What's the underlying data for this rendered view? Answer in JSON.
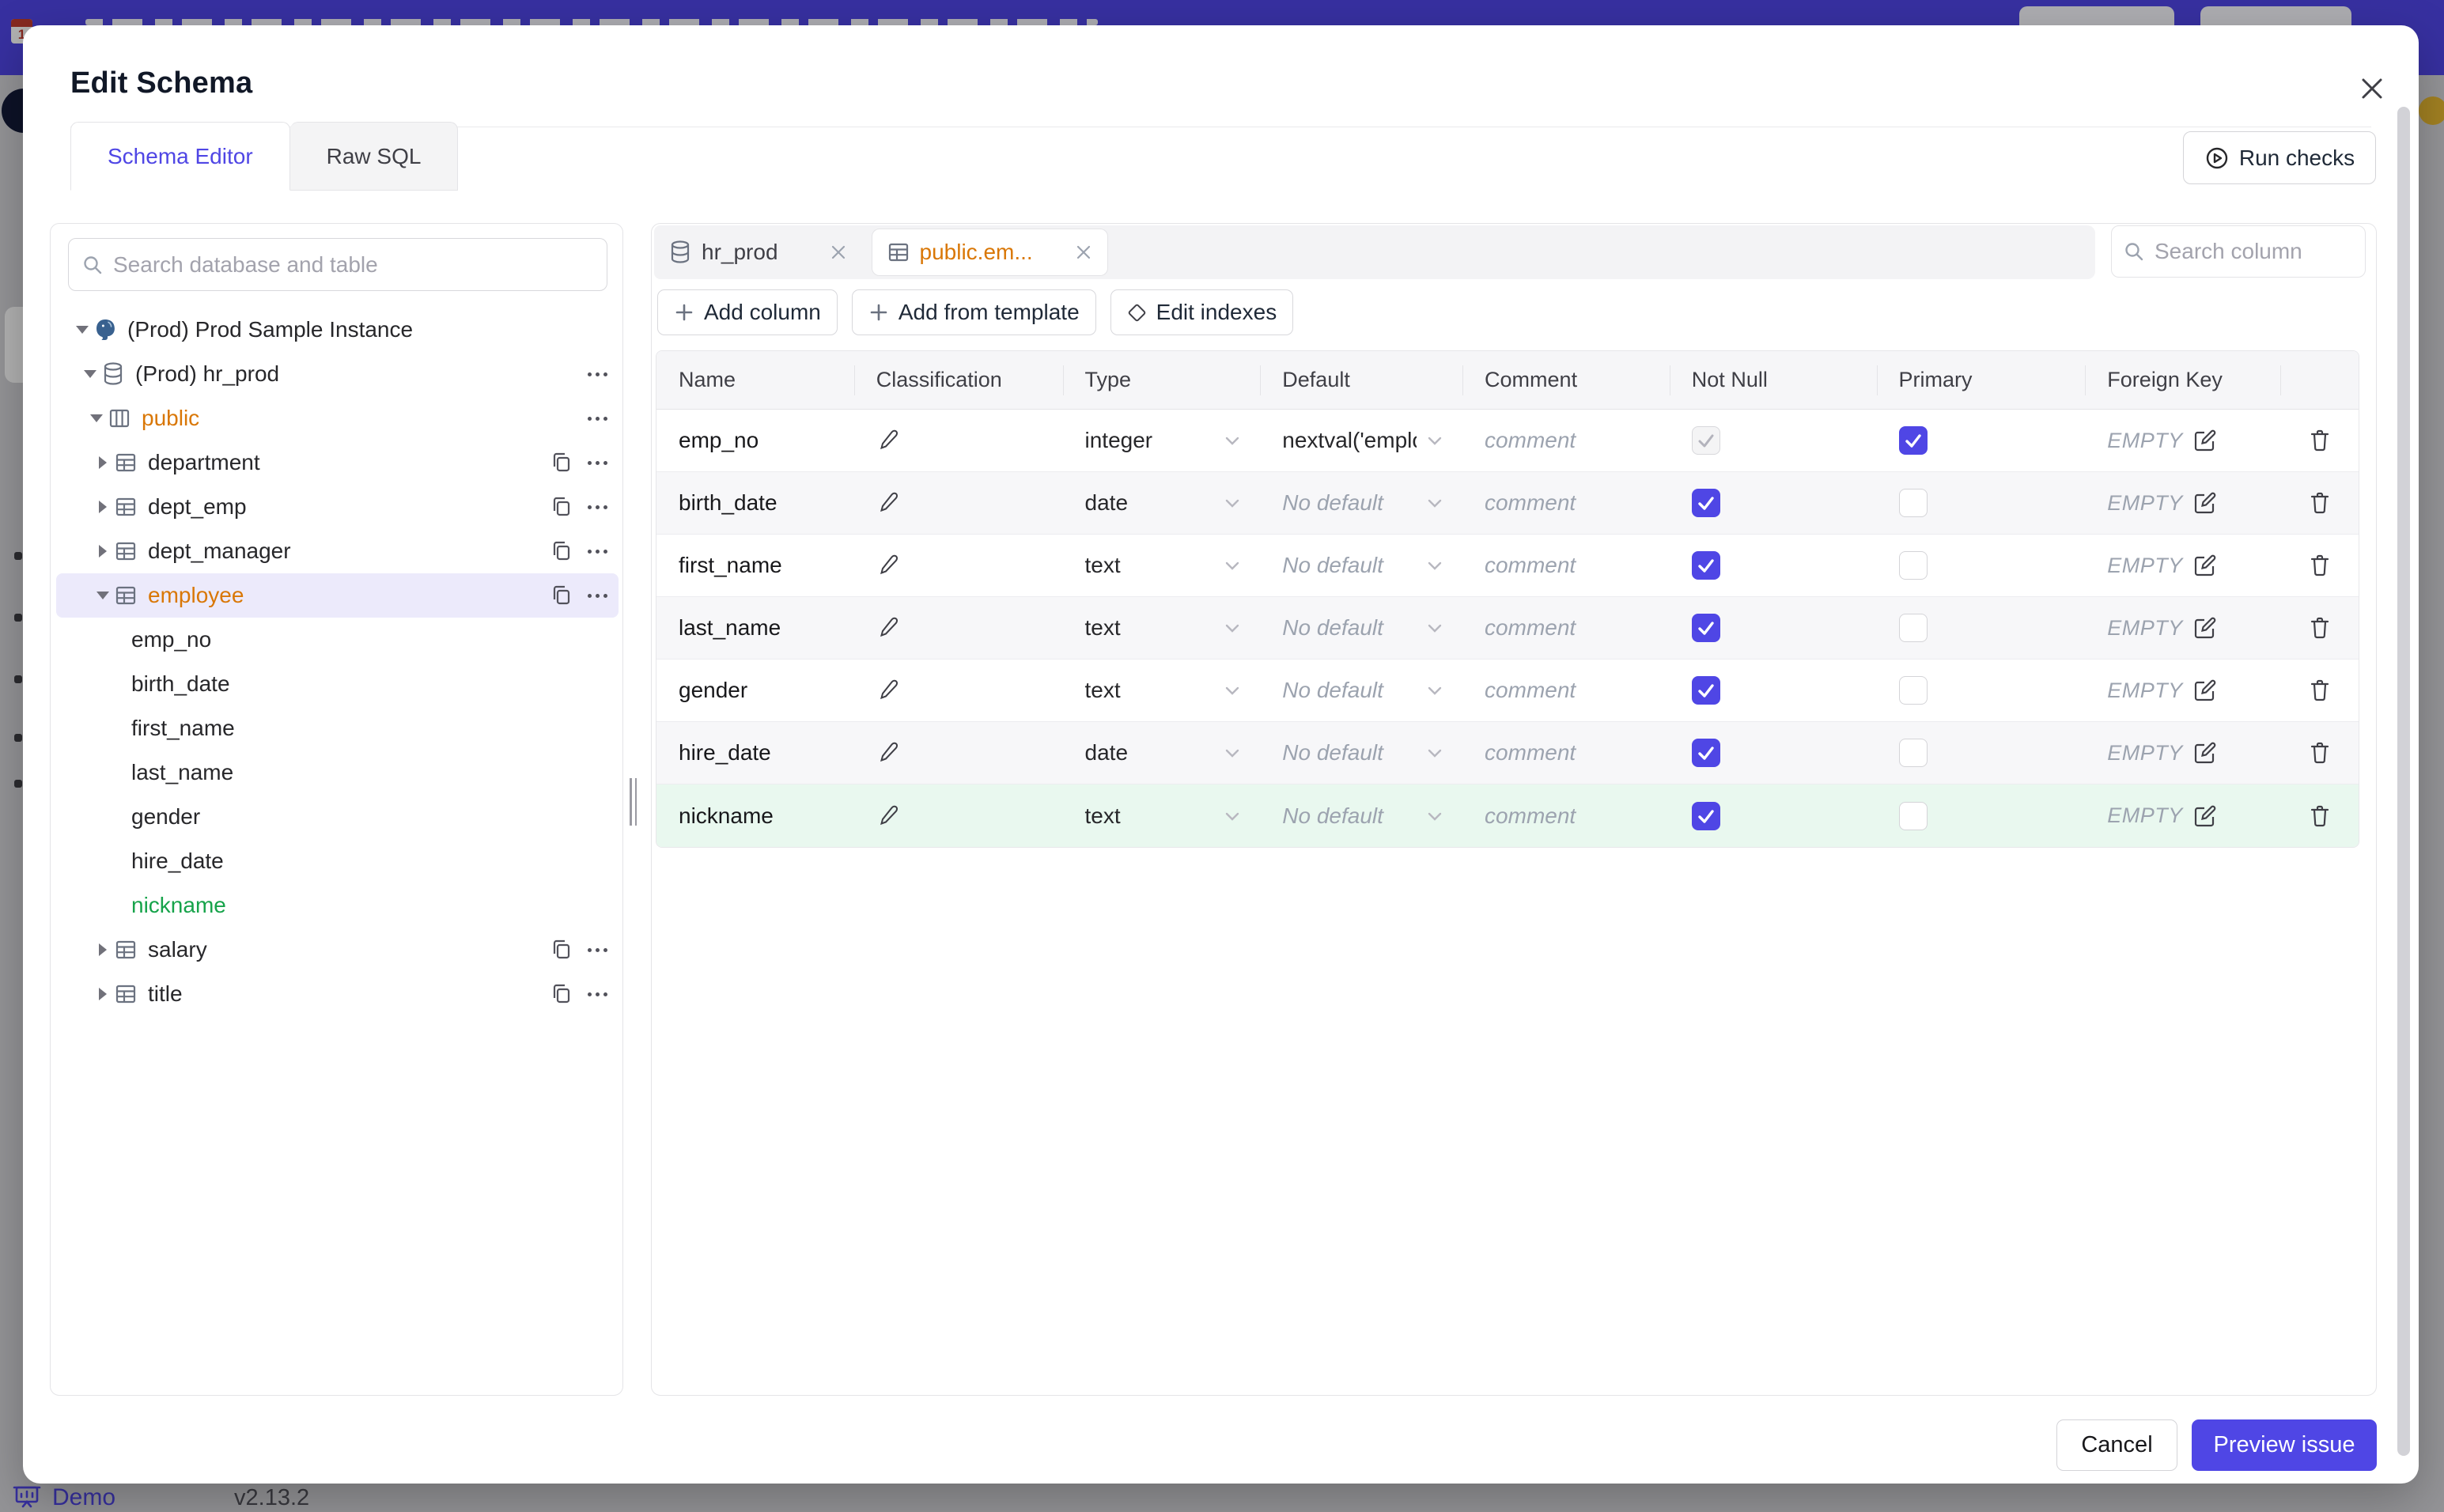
{
  "colors": {
    "accent": "#4f46e5",
    "banner": "#4f46e5",
    "modified_orange": "#d97706",
    "created_green": "#16a34a",
    "created_row_bg": "#e9f8ef",
    "selected_row_bg": "#eceafb"
  },
  "page": {
    "footer": {
      "demo_label": "Demo",
      "version": "v2.13.2"
    }
  },
  "modal": {
    "title": "Edit Schema",
    "tabs": [
      {
        "label": "Schema Editor",
        "active": true
      },
      {
        "label": "Raw SQL",
        "active": false
      }
    ],
    "run_checks_label": "Run checks",
    "footer": {
      "cancel_label": "Cancel",
      "submit_label": "Preview issue"
    }
  },
  "sidebar": {
    "search_placeholder": "Search database and table",
    "tree": [
      {
        "label": "(Prod) Prod Sample Instance",
        "level": 0,
        "caret": "down",
        "icon": "postgres-icon",
        "color": "default",
        "trailing": []
      },
      {
        "label": "(Prod) hr_prod",
        "level": 1,
        "caret": "down",
        "icon": "database-icon",
        "color": "default",
        "trailing": [
          "menu"
        ]
      },
      {
        "label": "public",
        "level": 2,
        "caret": "down",
        "icon": "schema-icon",
        "color": "orange",
        "trailing": [
          "menu"
        ]
      },
      {
        "label": "department",
        "level": 3,
        "caret": "right",
        "icon": "table-icon",
        "color": "default",
        "trailing": [
          "copy",
          "menu"
        ]
      },
      {
        "label": "dept_emp",
        "level": 3,
        "caret": "right",
        "icon": "table-icon",
        "color": "default",
        "trailing": [
          "copy",
          "menu"
        ]
      },
      {
        "label": "dept_manager",
        "level": 3,
        "caret": "right",
        "icon": "table-icon",
        "color": "default",
        "trailing": [
          "copy",
          "menu"
        ]
      },
      {
        "label": "employee",
        "level": 3,
        "caret": "down",
        "icon": "table-icon",
        "color": "orange",
        "selected": true,
        "trailing": [
          "copy",
          "menu"
        ]
      },
      {
        "label": "emp_no",
        "level": 4,
        "caret": null,
        "icon": null,
        "color": "default",
        "trailing": []
      },
      {
        "label": "birth_date",
        "level": 4,
        "caret": null,
        "icon": null,
        "color": "default",
        "trailing": []
      },
      {
        "label": "first_name",
        "level": 4,
        "caret": null,
        "icon": null,
        "color": "default",
        "trailing": []
      },
      {
        "label": "last_name",
        "level": 4,
        "caret": null,
        "icon": null,
        "color": "default",
        "trailing": []
      },
      {
        "label": "gender",
        "level": 4,
        "caret": null,
        "icon": null,
        "color": "default",
        "trailing": []
      },
      {
        "label": "hire_date",
        "level": 4,
        "caret": null,
        "icon": null,
        "color": "default",
        "trailing": []
      },
      {
        "label": "nickname",
        "level": 4,
        "caret": null,
        "icon": null,
        "color": "green",
        "trailing": []
      },
      {
        "label": "salary",
        "level": 3,
        "caret": "right",
        "icon": "table-icon",
        "color": "default",
        "trailing": [
          "copy",
          "menu"
        ]
      },
      {
        "label": "title",
        "level": 3,
        "caret": "right",
        "icon": "table-icon",
        "color": "default",
        "trailing": [
          "copy",
          "menu"
        ]
      }
    ]
  },
  "editor": {
    "chips": [
      {
        "label": "hr_prod",
        "icon": "database-icon",
        "active": false
      },
      {
        "label": "public.em...",
        "icon": "table-icon",
        "active": true
      }
    ],
    "actions": [
      {
        "label": "Add column",
        "icon": "plus-icon"
      },
      {
        "label": "Add from template",
        "icon": "plus-icon"
      },
      {
        "label": "Edit indexes",
        "icon": "diamond-icon"
      }
    ],
    "column_search_placeholder": "Search column",
    "table": {
      "headers": [
        "Name",
        "Classification",
        "Type",
        "Default",
        "Comment",
        "Not Null",
        "Primary",
        "Foreign Key"
      ],
      "comment_placeholder": "comment",
      "no_default_placeholder": "No default",
      "foreign_key_empty": "EMPTY",
      "rows": [
        {
          "name": "emp_no",
          "type": "integer",
          "default_value": "nextval('employ",
          "not_null_checked": true,
          "not_null_disabled": true,
          "primary_checked": true,
          "is_new": false
        },
        {
          "name": "birth_date",
          "type": "date",
          "default_value": "",
          "not_null_checked": true,
          "not_null_disabled": false,
          "primary_checked": false,
          "is_new": false
        },
        {
          "name": "first_name",
          "type": "text",
          "default_value": "",
          "not_null_checked": true,
          "not_null_disabled": false,
          "primary_checked": false,
          "is_new": false
        },
        {
          "name": "last_name",
          "type": "text",
          "default_value": "",
          "not_null_checked": true,
          "not_null_disabled": false,
          "primary_checked": false,
          "is_new": false
        },
        {
          "name": "gender",
          "type": "text",
          "default_value": "",
          "not_null_checked": true,
          "not_null_disabled": false,
          "primary_checked": false,
          "is_new": false
        },
        {
          "name": "hire_date",
          "type": "date",
          "default_value": "",
          "not_null_checked": true,
          "not_null_disabled": false,
          "primary_checked": false,
          "is_new": false
        },
        {
          "name": "nickname",
          "type": "text",
          "default_value": "",
          "not_null_checked": true,
          "not_null_disabled": false,
          "primary_checked": false,
          "is_new": true
        }
      ]
    }
  }
}
